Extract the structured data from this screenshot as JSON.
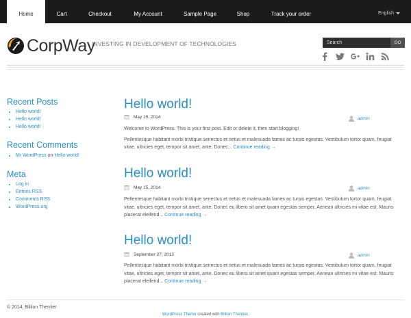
{
  "nav": {
    "items": [
      "Home",
      "Cart",
      "Checkout",
      "My Account",
      "Sample Page",
      "Shop",
      "Track your order"
    ],
    "language": "English"
  },
  "header": {
    "logo_text": "CorpWay",
    "tagline": "INVESTING IN DEVELOPMENT OF TECHNOLOGIES",
    "search_placeholder": "Search",
    "search_button": "GO",
    "social_icons": [
      "facebook-icon",
      "twitter-icon",
      "google-plus-icon",
      "linkedin-icon",
      "rss-icon"
    ]
  },
  "sidebar": {
    "recent_posts": {
      "title": "Recent Posts",
      "items": [
        "Hello world!",
        "Hello world!",
        "Hello world!"
      ]
    },
    "recent_comments": {
      "title": "Recent Comments",
      "items": [
        {
          "author": "Mr WordPress",
          "on": "on",
          "post": "Hello world!"
        }
      ]
    },
    "meta": {
      "title": "Meta",
      "items": [
        "Log in",
        "Entries RSS",
        "Comments RSS",
        "WordPress.org"
      ]
    }
  },
  "posts": [
    {
      "title": "Hello world!",
      "date": "May 15, 2014",
      "author": "admin",
      "paragraphs": [
        "Welcome to WordPress. This is your first post. Edit or delete it, then start blogging!",
        "Pellentesque habitant morbi tristique senectus et netus et malesuada fames ac turpis egestas. Vestibulum tortor quam, feugiat vitae, ultricies eget, tempor sit amet, ante. Donec..."
      ],
      "more": "Continue reading →"
    },
    {
      "title": "Hello world!",
      "date": "May 15, 2014",
      "author": "admin",
      "paragraphs": [
        "Pellentesque habitant morbi tristique senectus et netus et malesuada fames ac turpis egestas. Vestibulum tortor quam, feugiat vitae, ultricies eget, tempor sit amet, ante. Donec eu libero sit amet quam egestas semper. Aenean ultricies mi vitae est. Mauris placerat eleifend..."
      ],
      "more": "Continue reading →"
    },
    {
      "title": "Hello world!",
      "date": "September 27, 2013",
      "author": "admin",
      "paragraphs": [
        "Pellentesque habitant morbi tristique senectus et netus et malesuada fames ac turpis egestas. Vestibulum tortor quam, feugiat vitae, ultricies eget, tempor sit amet, ante. Donec eu libero sit amet quam egestas semper. Aenean ultricies mi vitae est. Mauris placerat eleifend..."
      ],
      "more": "Continue reading →"
    }
  ],
  "footer": {
    "copyright": "© 2014, Billion Themler",
    "credit_link1": "WordPress Theme",
    "credit_mid": "created with",
    "credit_link2": "Billion Themler",
    "credit_end": "."
  },
  "colors": {
    "accent": "#2a8fc9",
    "nav_bg": "#1b1b1b",
    "logo_orange": "#f0a21a"
  }
}
